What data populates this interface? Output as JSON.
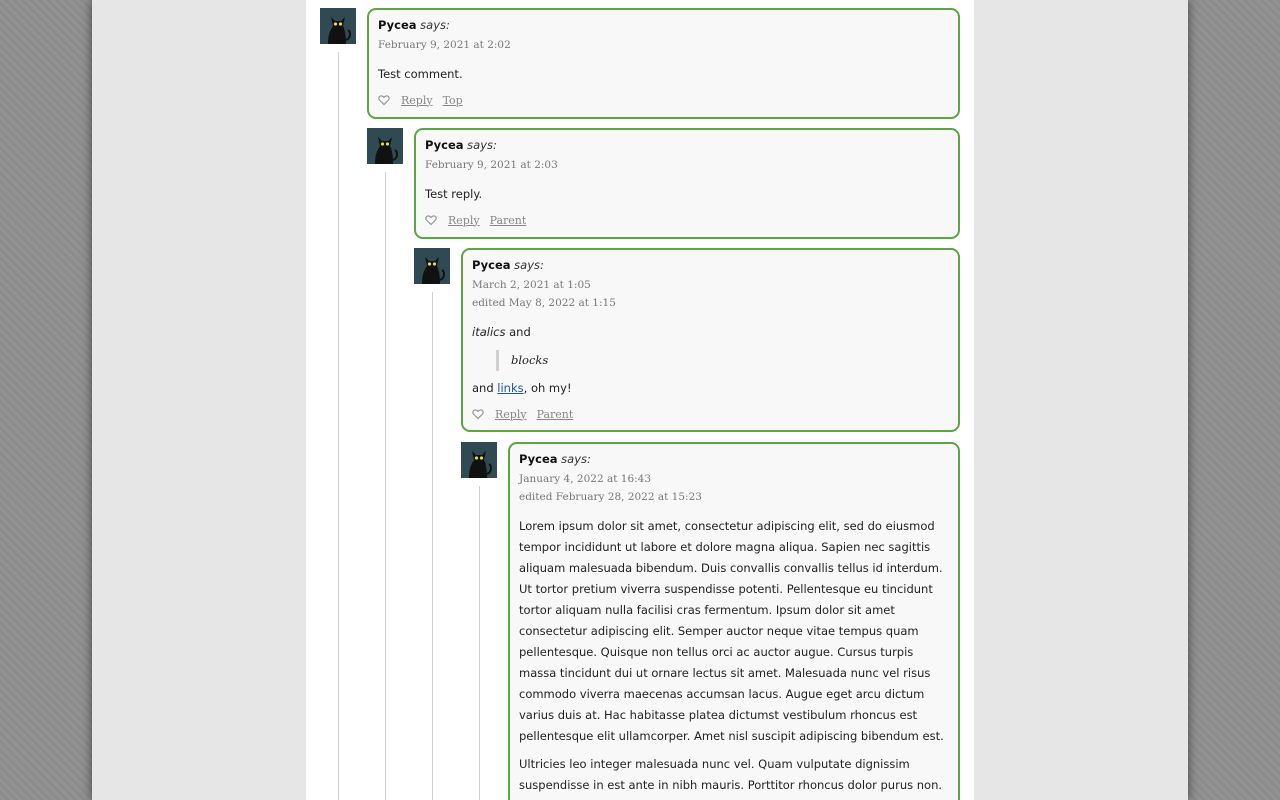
{
  "comments": [
    {
      "author": "Pycea",
      "says": "says:",
      "date": "February 9, 2021 at 2:02",
      "text": "Test comment.",
      "actions": {
        "reply": "Reply",
        "nav": "Top"
      }
    },
    {
      "author": "Pycea",
      "says": "says:",
      "date": "February 9, 2021 at 2:03",
      "text": "Test reply.",
      "actions": {
        "reply": "Reply",
        "nav": "Parent"
      }
    },
    {
      "author": "Pycea",
      "says": "says:",
      "date": "March 2, 2021 at 1:05",
      "edited": "edited May 8, 2022 at 1:15",
      "line1_em": "italics",
      "line1_rest": " and",
      "quote": "blocks",
      "line3_pre": "and ",
      "line3_link": "links",
      "line3_post": ", oh my!",
      "actions": {
        "reply": "Reply",
        "nav": "Parent"
      }
    },
    {
      "author": "Pycea",
      "says": "says:",
      "date": "January 4, 2022 at 16:43",
      "edited": "edited February 28, 2022 at 15:23",
      "para1": "Lorem ipsum dolor sit amet, consectetur adipiscing elit, sed do eiusmod tempor incididunt ut labore et dolore magna aliqua. Sapien nec sagittis aliquam malesuada bibendum. Duis convallis convallis tellus id interdum. Ut tortor pretium viverra suspendisse potenti. Pellentesque eu tincidunt tortor aliquam nulla facilisi cras fermentum. Ipsum dolor sit amet consectetur adipiscing elit. Semper auctor neque vitae tempus quam pellentesque. Quisque non tellus orci ac auctor augue. Cursus turpis massa tincidunt dui ut ornare lectus sit amet. Malesuada nunc vel risus commodo viverra maecenas accumsan lacus. Augue eget arcu dictum varius duis at. Hac habitasse platea dictumst vestibulum rhoncus est pellentesque elit ullamcorper. Amet nisl suscipit adipiscing bibendum est.",
      "para2": "Ultricies leo integer malesuada nunc vel. Quam vulputate dignissim suspendisse in est ante in nibh mauris. Porttitor rhoncus dolor purus non. Quis auctor elit sed"
    }
  ],
  "colors": {
    "border": "#5da443",
    "link": "#1d55a8"
  },
  "icons": {
    "avatar": "black-cat-avatar-icon",
    "like": "heart-outline-icon"
  }
}
